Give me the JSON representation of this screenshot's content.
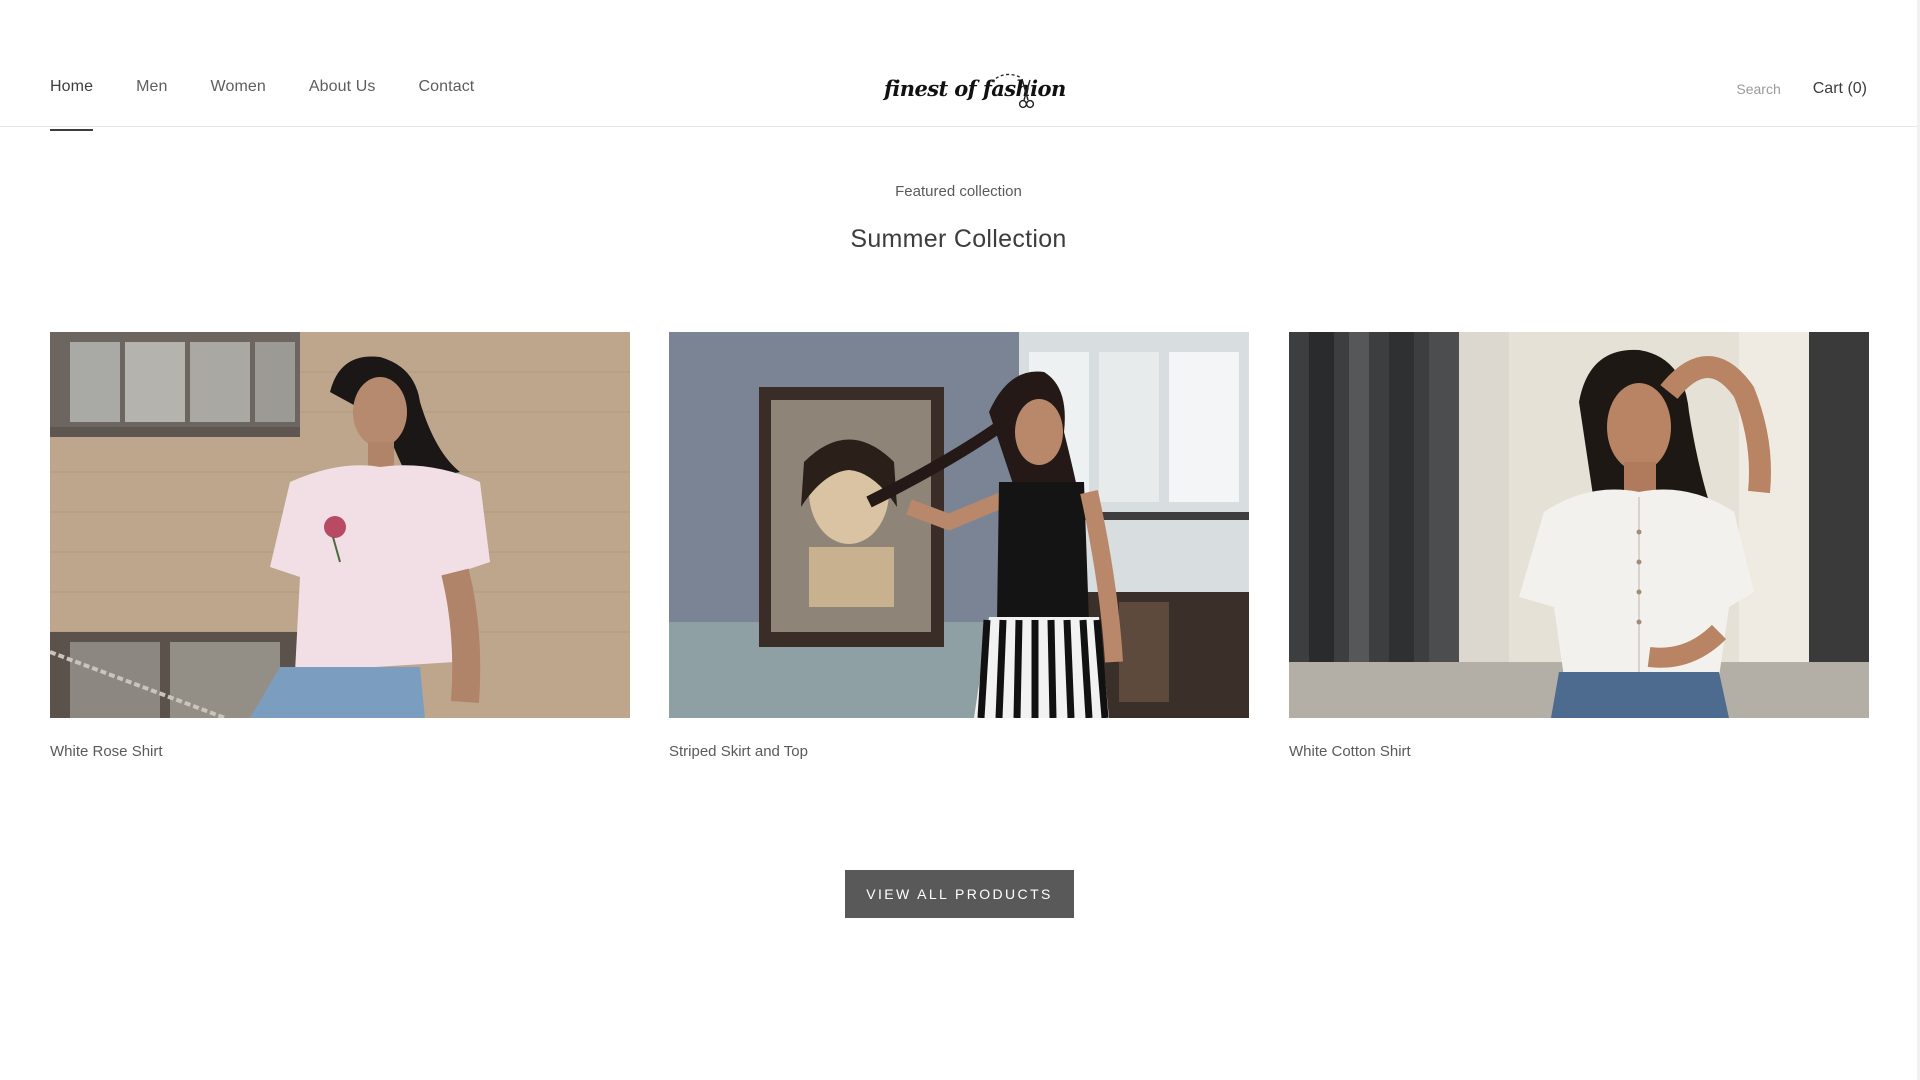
{
  "nav": {
    "items": [
      {
        "label": "Home",
        "active": true
      },
      {
        "label": "Men",
        "active": false
      },
      {
        "label": "Women",
        "active": false
      },
      {
        "label": "About Us",
        "active": false
      },
      {
        "label": "Contact",
        "active": false
      }
    ]
  },
  "logo": {
    "text": "finest of fashion",
    "icon": "scissors-icon"
  },
  "header": {
    "search_label": "Search",
    "cart_label": "Cart",
    "cart_count": "(0)"
  },
  "section": {
    "subtitle": "Featured collection",
    "title": "Summer Collection"
  },
  "products": [
    {
      "name": "White Rose Shirt",
      "image": "woman-white-rose-tshirt-photo"
    },
    {
      "name": "Striped Skirt and Top",
      "image": "woman-black-top-striped-skirt-photo"
    },
    {
      "name": "White Cotton Shirt",
      "image": "woman-white-cotton-shirt-photo"
    }
  ],
  "cta": {
    "label": "VIEW ALL PRODUCTS"
  },
  "colors": {
    "accent": "#595959",
    "text": "#3d3d3d",
    "muted": "#9a9a9a",
    "border": "#e6e6e6"
  }
}
